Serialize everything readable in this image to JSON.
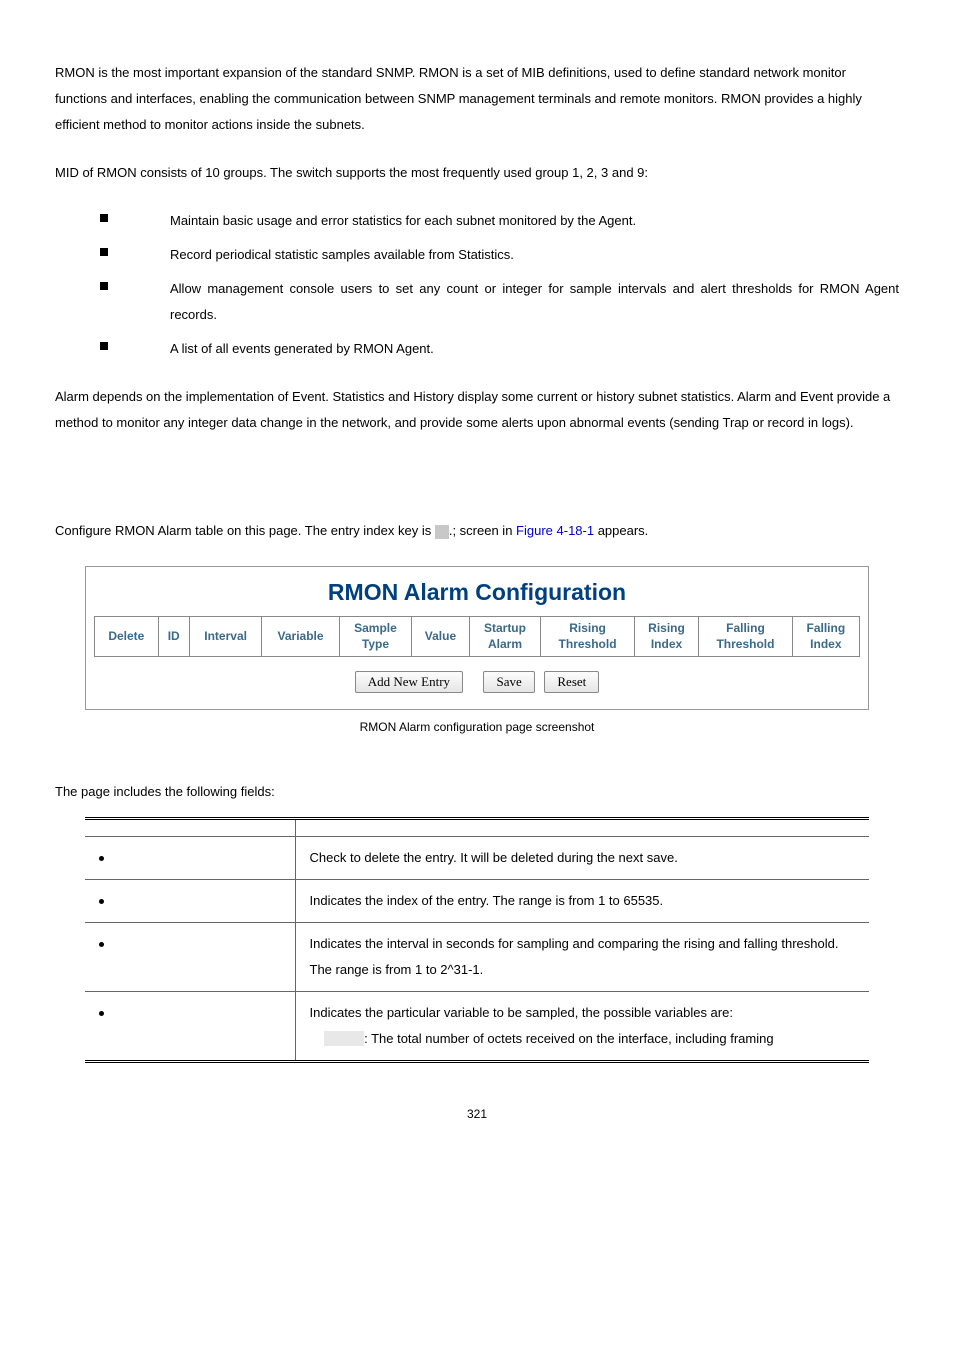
{
  "p1": "RMON is the most important expansion of the standard SNMP. RMON is a set of MIB definitions, used to define standard network monitor functions and interfaces, enabling the communication between SNMP management terminals and remote monitors. RMON provides a highly efficient method to monitor actions inside the subnets.",
  "p2": "MID of RMON consists of 10 groups. The switch supports the most frequently used group 1, 2, 3 and 9:",
  "bullets": [
    "Maintain basic usage and error statistics for each subnet monitored by the Agent.",
    "Record periodical statistic samples available from Statistics.",
    "Allow management console users to set any count or integer for sample intervals and alert thresholds for RMON Agent records.",
    "A list of all events generated by RMON Agent."
  ],
  "p3": "Alarm depends on the implementation of Event. Statistics and History display some current or history subnet statistics. Alarm and Event provide a method to monitor any integer data change in the network, and provide some alerts upon abnormal events (sending Trap or record in logs).",
  "config_prefix": "Configure RMON Alarm table on this page. The entry index key is ",
  "config_suffix1": ".; screen in ",
  "config_figref": "Figure 4-18-1",
  "config_suffix2": " appears.",
  "figure": {
    "title": "RMON Alarm Configuration",
    "headers_row": {
      "c1": "Delete",
      "c2": "ID",
      "c3": "Interval",
      "c4": "Variable",
      "c5a": "Sample",
      "c5b": "Type",
      "c6": "Value",
      "c7a": "Startup",
      "c7b": "Alarm",
      "c8a": "Rising",
      "c8b": "Threshold",
      "c9a": "Rising",
      "c9b": "Index",
      "c10a": "Falling",
      "c10b": "Threshold",
      "c11a": "Falling",
      "c11b": "Index"
    },
    "btn_add": "Add New Entry",
    "btn_save": "Save",
    "btn_reset": "Reset"
  },
  "caption": "RMON Alarm configuration page screenshot",
  "fields_intro": "The page includes the following fields:",
  "fields": {
    "delete": "Check to delete the entry. It will be deleted during the next save.",
    "id": "Indicates the index of the entry. The range is from 1 to 65535.",
    "interval": "Indicates the interval in seconds for sampling and comparing the rising and falling threshold. The range is from 1 to 2^31-1.",
    "variable1": "Indicates the particular variable to be sampled, the possible variables are:",
    "variable2": ": The total number of octets received on the interface, including framing"
  },
  "page_number": "321"
}
